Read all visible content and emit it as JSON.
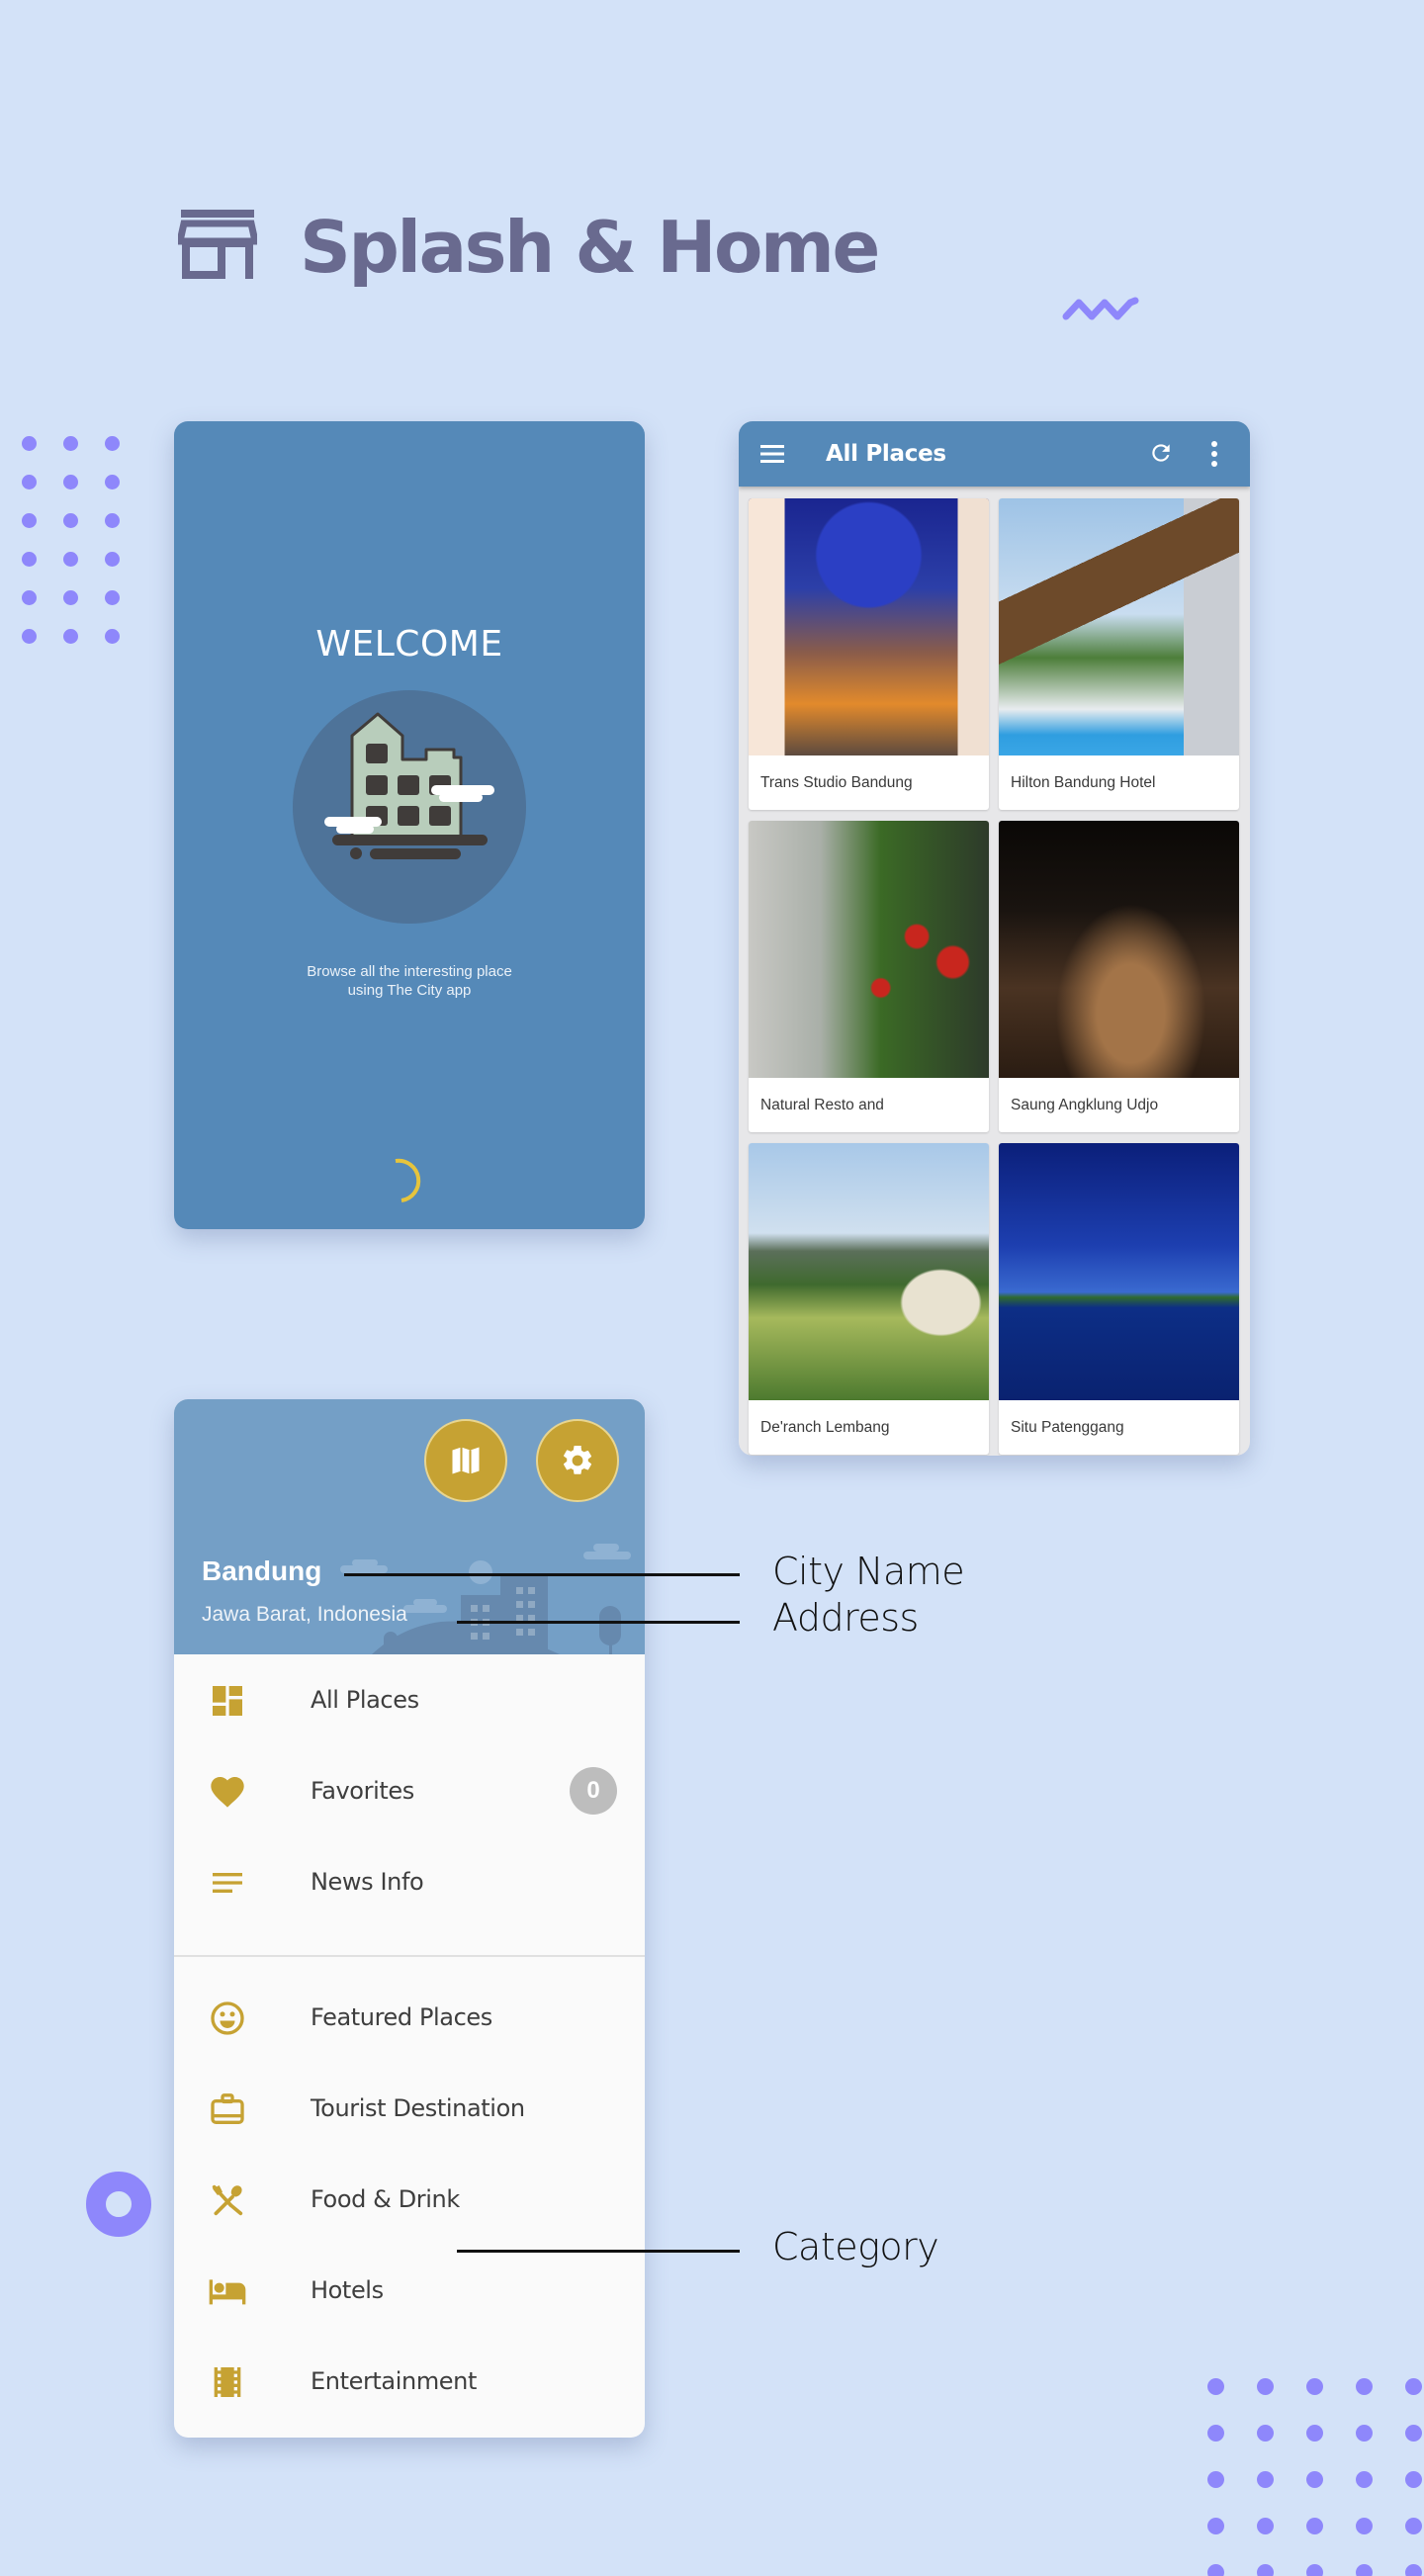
{
  "page": {
    "title": "Splash & Home",
    "title_icon": "storefront-icon",
    "accent_color": "#8E87FB",
    "title_color": "#696A8F",
    "background_color": "#D3E2F8"
  },
  "splash": {
    "heading": "WELCOME",
    "illustration": "city-building-illustration",
    "tagline_line1": "Browse all the interesting place",
    "tagline_line2": "using The City app",
    "loader": "loading-spinner",
    "background_color": "#5589B8",
    "spinner_color": "#E6C43C"
  },
  "all_places": {
    "toolbar": {
      "menu_icon": "hamburger-menu-icon",
      "title": "All Places",
      "refresh_icon": "refresh-icon",
      "more_icon": "more-vert-icon"
    },
    "places": [
      {
        "name": "Trans Studio Bandung",
        "image": "trans-studio-photo"
      },
      {
        "name": "Hilton Bandung Hotel",
        "image": "hilton-hotel-photo"
      },
      {
        "name": "Natural Resto and",
        "image": "strawberry-garden-photo"
      },
      {
        "name": "Saung Angklung Udjo",
        "image": "angklung-hall-photo"
      },
      {
        "name": "De'ranch Lembang",
        "image": "ranch-wagon-photo"
      },
      {
        "name": "Situ Patenggang",
        "image": "lake-boats-photo"
      }
    ]
  },
  "drawer": {
    "header": {
      "city_name": "Bandung",
      "address": "Jawa Barat, Indonesia",
      "map_button": "map-icon",
      "settings_button": "settings-icon"
    },
    "primary_items": [
      {
        "label": "All Places",
        "icon": "dashboard-icon"
      },
      {
        "label": "Favorites",
        "icon": "heart-icon",
        "badge": "0"
      },
      {
        "label": "News Info",
        "icon": "notes-icon"
      }
    ],
    "category_items": [
      {
        "label": "Featured Places",
        "icon": "smiley-icon"
      },
      {
        "label": "Tourist Destination",
        "icon": "suitcase-icon"
      },
      {
        "label": "Food & Drink",
        "icon": "fork-spoon-icon"
      },
      {
        "label": "Hotels",
        "icon": "bed-icon"
      },
      {
        "label": "Entertainment",
        "icon": "film-icon"
      }
    ],
    "icon_color": "#C6A233"
  },
  "annotations": {
    "city_name": "City Name",
    "address": "Address",
    "category": "Category"
  }
}
